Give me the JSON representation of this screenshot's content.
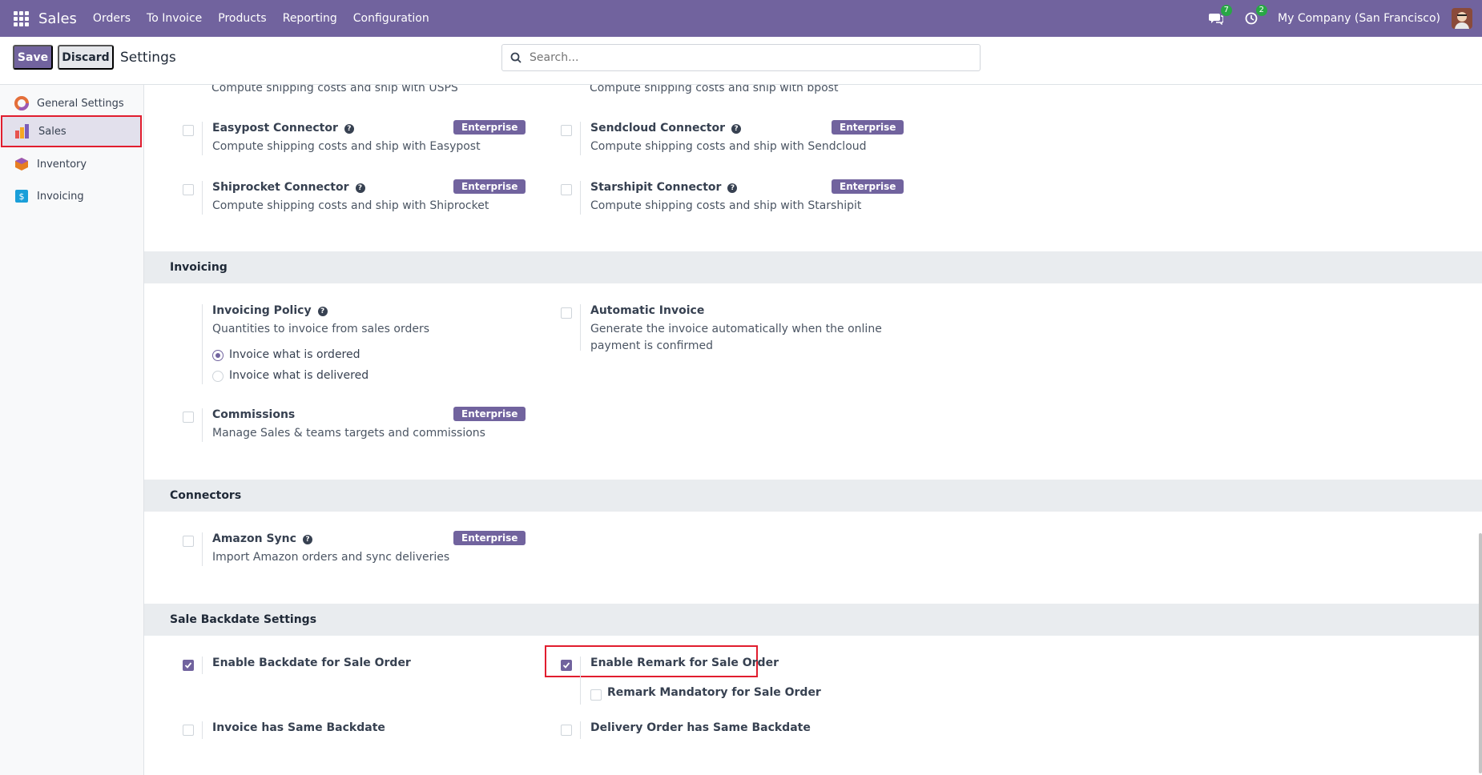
{
  "navbar": {
    "brand": "Sales",
    "menu": [
      "Orders",
      "To Invoice",
      "Products",
      "Reporting",
      "Configuration"
    ],
    "messages_count": "7",
    "activities_count": "2",
    "company": "My Company (San Francisco)"
  },
  "control_panel": {
    "save_label": "Save",
    "discard_label": "Discard",
    "title": "Settings",
    "search_placeholder": "Search..."
  },
  "sidebar": {
    "items": [
      {
        "label": "General Settings",
        "icon": "odoo-logo-icon"
      },
      {
        "label": "Sales",
        "icon": "sales-chart-icon"
      },
      {
        "label": "Inventory",
        "icon": "inventory-box-icon"
      },
      {
        "label": "Invoicing",
        "icon": "invoicing-icon"
      }
    ]
  },
  "shipping": {
    "usps_desc": "Compute shipping costs and ship with USPS",
    "bpost_desc": "Compute shipping costs and ship with bpost",
    "easypost": {
      "title": "Easypost Connector",
      "desc": "Compute shipping costs and ship with Easypost"
    },
    "sendcloud": {
      "title": "Sendcloud Connector",
      "desc": "Compute shipping costs and ship with Sendcloud"
    },
    "shiprocket": {
      "title": "Shiprocket Connector",
      "desc": "Compute shipping costs and ship with Shiprocket"
    },
    "starshipit": {
      "title": "Starshipit Connector",
      "desc": "Compute shipping costs and ship with Starshipit"
    }
  },
  "enterprise_label": "Enterprise",
  "invoicing": {
    "heading": "Invoicing",
    "policy": {
      "title": "Invoicing Policy",
      "desc": "Quantities to invoice from sales orders",
      "options": [
        "Invoice what is ordered",
        "Invoice what is delivered"
      ],
      "selected": 0
    },
    "auto_invoice": {
      "title": "Automatic Invoice",
      "desc": "Generate the invoice automatically when the online payment is confirmed"
    },
    "commissions": {
      "title": "Commissions",
      "desc": "Manage Sales & teams targets and commissions"
    }
  },
  "connectors": {
    "heading": "Connectors",
    "amazon": {
      "title": "Amazon Sync",
      "desc": "Import Amazon orders and sync deliveries"
    }
  },
  "backdate": {
    "heading": "Sale Backdate Settings",
    "enable_backdate": "Enable Backdate for Sale Order",
    "enable_remark": "Enable Remark for Sale Order",
    "remark_mandatory": "Remark Mandatory for Sale Order",
    "invoice_same": "Invoice has Same Backdate",
    "delivery_same": "Delivery Order has Same Backdate"
  },
  "colors": {
    "brand": "#71639e",
    "highlight": "#e11d2e",
    "badge_green": "#28a745"
  }
}
